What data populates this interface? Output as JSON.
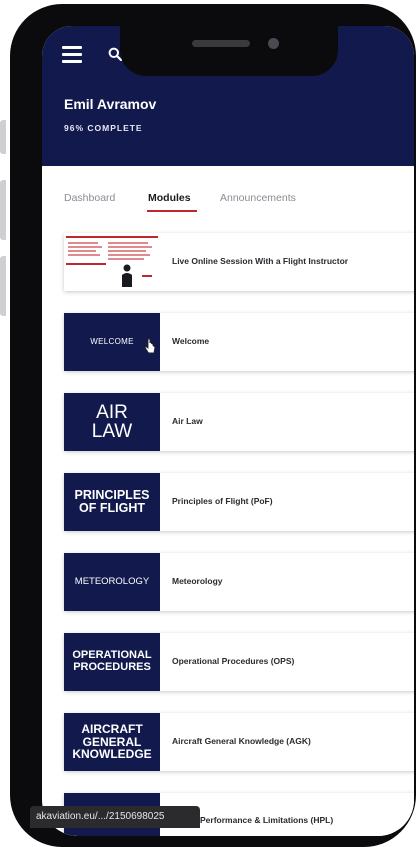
{
  "header": {
    "user_name": "Emil Avramov",
    "progress": "96% COMPLETE"
  },
  "tabs": [
    {
      "label": "Dashboard"
    },
    {
      "label": "Modules"
    },
    {
      "label": "Announcements"
    }
  ],
  "modules": [
    {
      "thumb": "",
      "title": "Live Online Session With a Flight Instructor"
    },
    {
      "thumb": "WELCOME",
      "title": "Welcome"
    },
    {
      "thumb": "AIR LAW",
      "title": "Air Law"
    },
    {
      "thumb": "PRINCIPLES OF FLIGHT",
      "title": "Principles of Flight (PoF)"
    },
    {
      "thumb": "METEOROLOGY",
      "title": "Meteorology"
    },
    {
      "thumb": "OPERATIONAL PROCEDURES",
      "title": "Operational Procedures (OPS)"
    },
    {
      "thumb": "AIRCRAFT GENERAL KNOWLEDGE",
      "title": "Aircraft General Knowledge (AGK)"
    },
    {
      "thumb": "",
      "title": "Performance & Limitations (HPL)"
    }
  ],
  "status_url": "akaviation.eu/.../2150698025",
  "colors": {
    "brand_navy": "#121a4d",
    "accent_red": "#c0262d"
  },
  "icons": [
    "menu-icon",
    "search-icon",
    "pointer-cursor-icon"
  ]
}
